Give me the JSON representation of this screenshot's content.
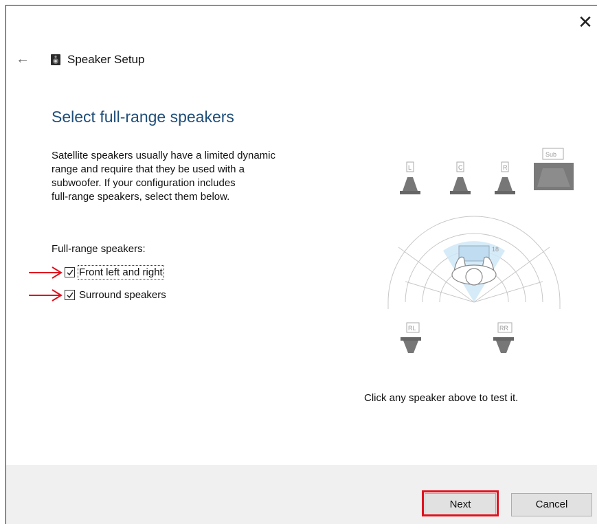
{
  "window": {
    "title": "Speaker Setup",
    "close_glyph": "✕",
    "back_glyph": "←"
  },
  "content": {
    "heading": "Select full-range speakers",
    "description_lines": [
      "Satellite speakers usually have a limited dynamic",
      "range and require that they be used with a",
      "subwoofer.  If your configuration includes",
      "full-range speakers, select them below."
    ],
    "full_range_label": "Full-range speakers:",
    "checkboxes": [
      {
        "label": "Front left and right",
        "checked": true,
        "focused": true
      },
      {
        "label": "Surround speakers",
        "checked": true,
        "focused": false
      }
    ]
  },
  "diagram": {
    "speakers": [
      "L",
      "C",
      "R",
      "Sub",
      "RL",
      "RR"
    ],
    "center_label": "18"
  },
  "hint": "Click any speaker above to test it.",
  "footer": {
    "next_label": "Next",
    "cancel_label": "Cancel"
  },
  "colors": {
    "heading": "#1f4e79",
    "annotation": "#e0101d",
    "listener_zone": "#cfe8f7"
  },
  "icons": {
    "app": "speaker-icon",
    "back": "back-arrow-icon",
    "close": "close-icon"
  }
}
